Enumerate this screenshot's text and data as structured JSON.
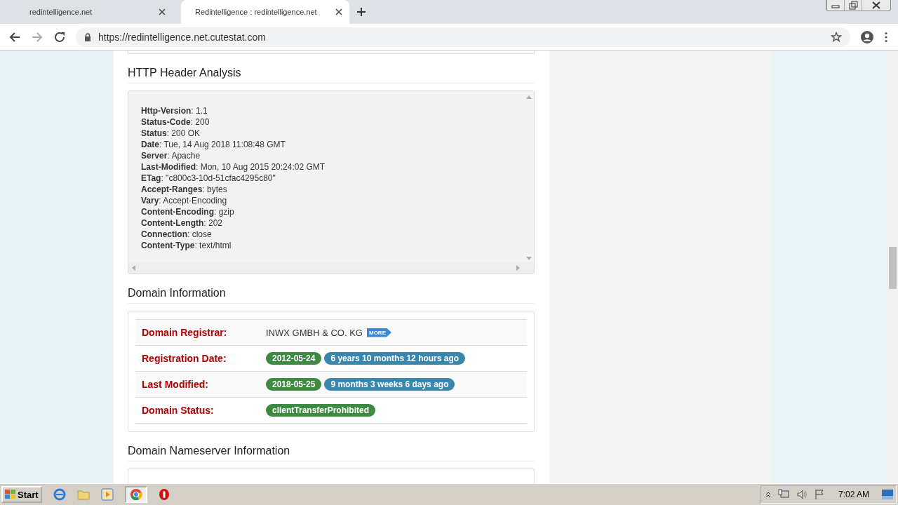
{
  "tabs": [
    {
      "label": "redintelligence.net",
      "selected": false
    },
    {
      "label": "Redintelligence : redintelligence.net",
      "selected": true
    }
  ],
  "address_bar": {
    "url": "https://redintelligence.net.cutestat.com"
  },
  "http_header_analysis": {
    "title": "HTTP Header Analysis",
    "headers": [
      "**Http-Version**: 1.1",
      "**Status-Code**: 200",
      "**Status**: 200 OK",
      "**Date**: Tue, 14 Aug 2018 11:08:48 GMT",
      "**Server**: Apache",
      "**Last-Modified**: Mon, 10 Aug 2015 20:24:02 GMT",
      "**ETag**: \"c800c3-10d-51cfac4295c80\"",
      "**Accept-Ranges**: bytes",
      "**Vary**: Accept-Encoding",
      "**Content-Encoding**: gzip",
      "**Content-Length**: 202",
      "**Connection**: close",
      "**Content-Type**: text/html"
    ]
  },
  "domain_information": {
    "title": "Domain Information",
    "rows": [
      {
        "label": "Domain Registrar:",
        "kind": "text",
        "value": "INWX GMBH & CO. KG",
        "more": "MORE"
      },
      {
        "label": "Registration Date:",
        "kind": "badges",
        "badges": [
          {
            "text": "2012-05-24",
            "color": "#3d8b40"
          },
          {
            "text": "6 years 10 months 12 hours ago",
            "color": "#3a87ad"
          }
        ]
      },
      {
        "label": "Last Modified:",
        "kind": "badges",
        "badges": [
          {
            "text": "2018-05-25",
            "color": "#3d8b40"
          },
          {
            "text": "9 months 3 weeks 6 days ago",
            "color": "#3a87ad"
          }
        ]
      },
      {
        "label": "Domain Status:",
        "kind": "badges",
        "badges": [
          {
            "text": "clientTransferProhibited",
            "color": "#3d8b40"
          }
        ]
      }
    ]
  },
  "domain_nameserver_information": {
    "title": "Domain Nameserver Information"
  },
  "taskbar": {
    "start": "Start",
    "clock": "7:02 AM"
  }
}
